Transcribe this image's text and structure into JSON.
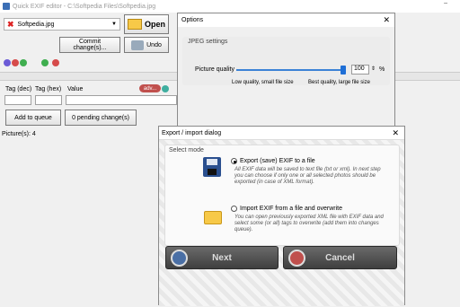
{
  "window": {
    "title": "Quick EXIF editor - C:\\Softpedia Files\\Softpedia.jpg",
    "minimize": "–"
  },
  "toolbar": {
    "file_combo": "Softpedia.jpg",
    "open_label": "Open",
    "commit_label_1": "Commit",
    "commit_label_2": "change(s)...",
    "undo_label": "Undo"
  },
  "table": {
    "col_tag_dec": "Tag (dec)",
    "col_tag_hex": "Tag (hex)",
    "col_value": "Value",
    "adv_label": "adv..."
  },
  "actions": {
    "add_to_queue": "Add to queue",
    "pending": "0 pending change(s)"
  },
  "status": {
    "pictures": "Picture(s): 4"
  },
  "options_dialog": {
    "title": "Options",
    "close": "✕",
    "group_label": "JPEG settings",
    "quality_label": "Picture quality",
    "quality_value": 100,
    "quality_unit": "%",
    "low_label": "Low quality, small file size",
    "best_label": "Best quality, large file size"
  },
  "export_dialog": {
    "title": "Export / import dialog",
    "close": "✕",
    "group_label": "Select mode",
    "export_option": "Export (save) EXIF to a file",
    "export_desc_1": "All EXIF data will be saved to text file (txt or xml). In next step",
    "export_desc_2": "you can choose if only one or all selected photos should be",
    "export_desc_3": "exported (in case of XML format).",
    "import_option": "Import EXIF from a file and overwrite",
    "import_desc_1": "You can open previously exported XML file with EXIF data and",
    "import_desc_2": "select some (or all) tags to overwrite (add them into changes",
    "import_desc_3": "queue).",
    "next_label": "Next",
    "cancel_label": "Cancel"
  },
  "colors": {
    "accent": "#1f6fd6",
    "adv": "#c0504d"
  }
}
